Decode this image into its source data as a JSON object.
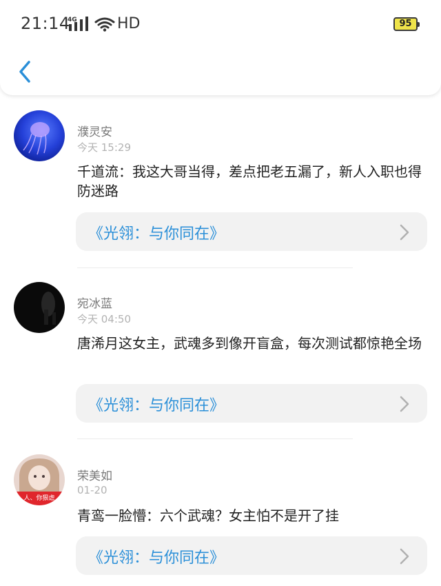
{
  "status_bar": {
    "time": "21:14",
    "network": "4G",
    "hd": "HD",
    "battery": "95"
  },
  "nav": {
    "back_icon": "chevron-left-icon"
  },
  "colors": {
    "accent": "#2a8fd8",
    "battery": "#efe44a"
  },
  "comments": [
    {
      "name": "濮灵安",
      "time": "今天 15:29",
      "content": "千道流：我这大哥当得，差点把老五漏了，新人入职也得防迷路",
      "link_title": "《光翎：与你同在》"
    },
    {
      "name": "宛冰蓝",
      "time": "今天 04:50",
      "content": "唐浠月这女主，武魂多到像开盲盒，每次测试都惊艳全场",
      "link_title": "《光翎：与你同在》"
    },
    {
      "name": "荣美如",
      "time": "01-20",
      "content": "青鸾一脸懵：六个武魂？女主怕不是开了挂",
      "link_title": "《光翎：与你同在》",
      "avatar_caption": "人、你狠虐"
    }
  ]
}
